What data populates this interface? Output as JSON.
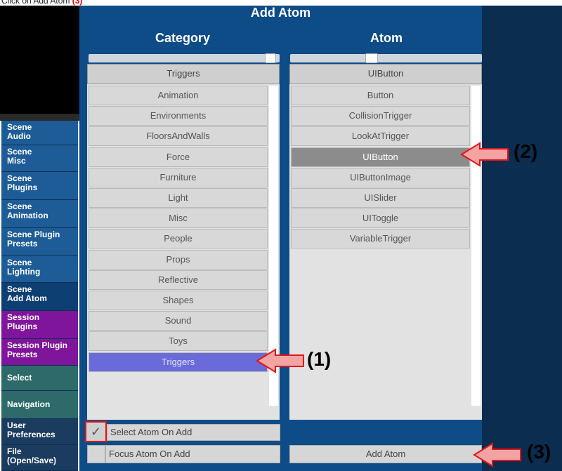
{
  "instruction": {
    "prefix": "Click on Add Atom",
    "step": "(3)"
  },
  "sidebar": [
    {
      "line1": "Scene",
      "line2": "Audio"
    },
    {
      "line1": "Scene",
      "line2": "Misc"
    },
    {
      "line1": "Scene",
      "line2": "Plugins"
    },
    {
      "line1": "Scene",
      "line2": "Animation"
    },
    {
      "line1": "Scene Plugin",
      "line2": "Presets"
    },
    {
      "line1": "Scene",
      "line2": "Lighting"
    },
    {
      "line1": "Scene",
      "line2": "Add Atom"
    },
    {
      "line1": "Session",
      "line2": "Plugins"
    },
    {
      "line1": "Session Plugin",
      "line2": "Presets"
    },
    {
      "line1": "Select",
      "line2": ""
    },
    {
      "line1": "Navigation",
      "line2": ""
    },
    {
      "line1": "User",
      "line2": "Preferences"
    },
    {
      "line1": "File",
      "line2": "(Open/Save)"
    }
  ],
  "panel": {
    "title": "Add Atom"
  },
  "category": {
    "header": "Category",
    "selected": "Triggers",
    "items": [
      "Animation",
      "Environments",
      "FloorsAndWalls",
      "Force",
      "Furniture",
      "Light",
      "Misc",
      "People",
      "Props",
      "Reflective",
      "Shapes",
      "Sound",
      "Toys",
      "Triggers"
    ],
    "slider_level": 0.98
  },
  "atom": {
    "header": "Atom",
    "selected": "UIButton",
    "items": [
      "Button",
      "CollisionTrigger",
      "LookAtTrigger",
      "UIButton",
      "UIButtonImage",
      "UISlider",
      "UIToggle",
      "VariableTrigger"
    ],
    "slider_level": 0.42
  },
  "options": {
    "select_atom_on_add": "Select Atom On Add",
    "select_checked": "✓",
    "focus_atom_on_add": "Focus Atom On Add",
    "add_atom_button": "Add Atom"
  },
  "callouts": {
    "one": "(1)",
    "two": "(2)",
    "three": "(3)"
  },
  "colors": {
    "panel": "#0d4c86",
    "selected_category": "#6a6ad8",
    "callout_arrow": "#f4a3a3",
    "callout_arrow_border": "#e01515"
  }
}
